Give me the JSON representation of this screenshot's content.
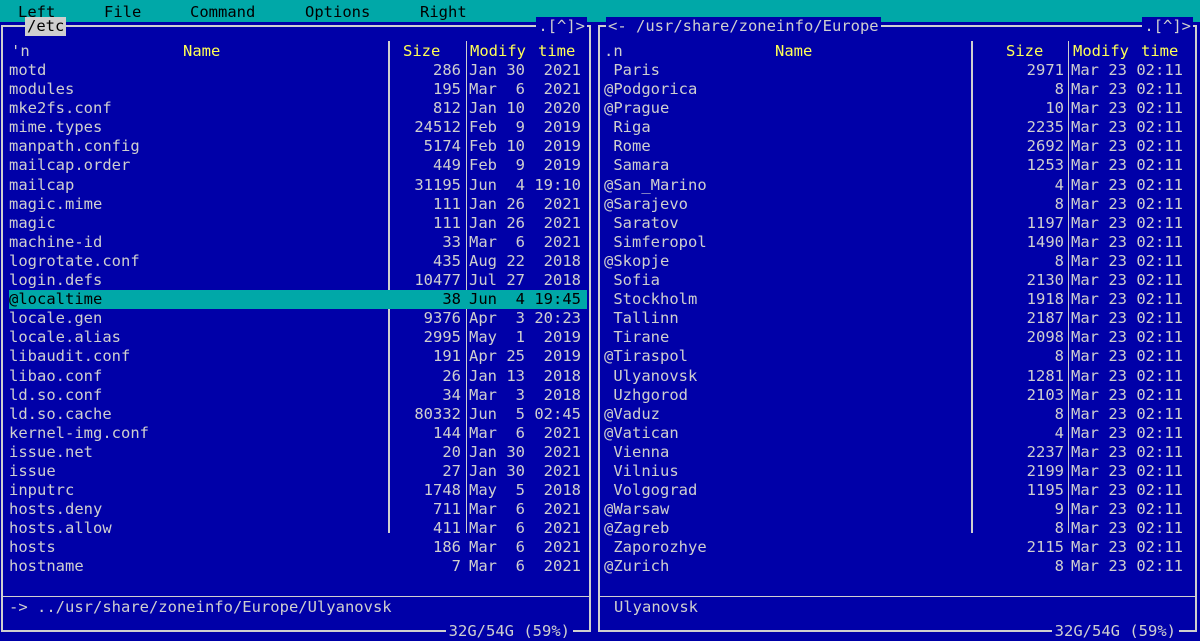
{
  "menu": [
    "Left",
    "File",
    "Command",
    "Options",
    "Right"
  ],
  "left": {
    "path": "/etc",
    "corner": ".[^]>",
    "header": {
      "sort": "'n",
      "name": "Name",
      "size": "Size",
      "modify": "Modify",
      "time": "time"
    },
    "rows": [
      {
        "name": "motd",
        "size": "286",
        "date": "Jan 30  2021"
      },
      {
        "name": "modules",
        "size": "195",
        "date": "Mar  6  2021"
      },
      {
        "name": "mke2fs.conf",
        "size": "812",
        "date": "Jan 10  2020"
      },
      {
        "name": "mime.types",
        "size": "24512",
        "date": "Feb  9  2019"
      },
      {
        "name": "manpath.config",
        "size": "5174",
        "date": "Feb 10  2019"
      },
      {
        "name": "mailcap.order",
        "size": "449",
        "date": "Feb  9  2019"
      },
      {
        "name": "mailcap",
        "size": "31195",
        "date": "Jun  4 19:10"
      },
      {
        "name": "magic.mime",
        "size": "111",
        "date": "Jan 26  2021"
      },
      {
        "name": "magic",
        "size": "111",
        "date": "Jan 26  2021"
      },
      {
        "name": "machine-id",
        "size": "33",
        "date": "Mar  6  2021"
      },
      {
        "name": "logrotate.conf",
        "size": "435",
        "date": "Aug 22  2018"
      },
      {
        "name": "login.defs",
        "size": "10477",
        "date": "Jul 27  2018"
      },
      {
        "name": "@localtime",
        "size": "38",
        "date": "Jun  4 19:45"
      },
      {
        "name": "locale.gen",
        "size": "9376",
        "date": "Apr  3 20:23"
      },
      {
        "name": "locale.alias",
        "size": "2995",
        "date": "May  1  2019"
      },
      {
        "name": "libaudit.conf",
        "size": "191",
        "date": "Apr 25  2019"
      },
      {
        "name": "libao.conf",
        "size": "26",
        "date": "Jan 13  2018"
      },
      {
        "name": "ld.so.conf",
        "size": "34",
        "date": "Mar  3  2018"
      },
      {
        "name": "ld.so.cache",
        "size": "80332",
        "date": "Jun  5 02:45"
      },
      {
        "name": "kernel-img.conf",
        "size": "144",
        "date": "Mar  6  2021"
      },
      {
        "name": "issue.net",
        "size": "20",
        "date": "Jan 30  2021"
      },
      {
        "name": "issue",
        "size": "27",
        "date": "Jan 30  2021"
      },
      {
        "name": "inputrc",
        "size": "1748",
        "date": "May  5  2018"
      },
      {
        "name": "hosts.deny",
        "size": "711",
        "date": "Mar  6  2021"
      },
      {
        "name": "hosts.allow",
        "size": "411",
        "date": "Mar  6  2021"
      },
      {
        "name": "hosts",
        "size": "186",
        "date": "Mar  6  2021"
      },
      {
        "name": "hostname",
        "size": "7",
        "date": "Mar  6  2021"
      }
    ],
    "status": "-> ../usr/share/zoneinfo/Europe/Ulyanovsk",
    "free": "32G/54G (59%)"
  },
  "right": {
    "path": "<- /usr/share/zoneinfo/Europe",
    "corner": ".[^]>",
    "header": {
      "sort": ".n",
      "name": "Name",
      "size": "Size",
      "modify": "Modify",
      "time": "time"
    },
    "rows": [
      {
        "name": " Paris",
        "size": "2971",
        "date": "Mar 23 02:11"
      },
      {
        "name": "@Podgorica",
        "size": "8",
        "date": "Mar 23 02:11"
      },
      {
        "name": "@Prague",
        "size": "10",
        "date": "Mar 23 02:11"
      },
      {
        "name": " Riga",
        "size": "2235",
        "date": "Mar 23 02:11"
      },
      {
        "name": " Rome",
        "size": "2692",
        "date": "Mar 23 02:11"
      },
      {
        "name": " Samara",
        "size": "1253",
        "date": "Mar 23 02:11"
      },
      {
        "name": "@San_Marino",
        "size": "4",
        "date": "Mar 23 02:11"
      },
      {
        "name": "@Sarajevo",
        "size": "8",
        "date": "Mar 23 02:11"
      },
      {
        "name": " Saratov",
        "size": "1197",
        "date": "Mar 23 02:11"
      },
      {
        "name": " Simferopol",
        "size": "1490",
        "date": "Mar 23 02:11"
      },
      {
        "name": "@Skopje",
        "size": "8",
        "date": "Mar 23 02:11"
      },
      {
        "name": " Sofia",
        "size": "2130",
        "date": "Mar 23 02:11"
      },
      {
        "name": " Stockholm",
        "size": "1918",
        "date": "Mar 23 02:11"
      },
      {
        "name": " Tallinn",
        "size": "2187",
        "date": "Mar 23 02:11"
      },
      {
        "name": " Tirane",
        "size": "2098",
        "date": "Mar 23 02:11"
      },
      {
        "name": "@Tiraspol",
        "size": "8",
        "date": "Mar 23 02:11"
      },
      {
        "name": " Ulyanovsk",
        "size": "1281",
        "date": "Mar 23 02:11"
      },
      {
        "name": " Uzhgorod",
        "size": "2103",
        "date": "Mar 23 02:11"
      },
      {
        "name": "@Vaduz",
        "size": "8",
        "date": "Mar 23 02:11"
      },
      {
        "name": "@Vatican",
        "size": "4",
        "date": "Mar 23 02:11"
      },
      {
        "name": " Vienna",
        "size": "2237",
        "date": "Mar 23 02:11"
      },
      {
        "name": " Vilnius",
        "size": "2199",
        "date": "Mar 23 02:11"
      },
      {
        "name": " Volgograd",
        "size": "1195",
        "date": "Mar 23 02:11"
      },
      {
        "name": "@Warsaw",
        "size": "9",
        "date": "Mar 23 02:11"
      },
      {
        "name": "@Zagreb",
        "size": "8",
        "date": "Mar 23 02:11"
      },
      {
        "name": " Zaporozhye",
        "size": "2115",
        "date": "Mar 23 02:11"
      },
      {
        "name": "@Zurich",
        "size": "8",
        "date": "Mar 23 02:11"
      }
    ],
    "status": "Ulyanovsk",
    "free": "32G/54G (59%)"
  },
  "selected_left_index": 12,
  "colors": {
    "background": "#0000a8",
    "accent": "#00a8a8",
    "text": "#cfcfcf",
    "header": "#ffff55"
  }
}
